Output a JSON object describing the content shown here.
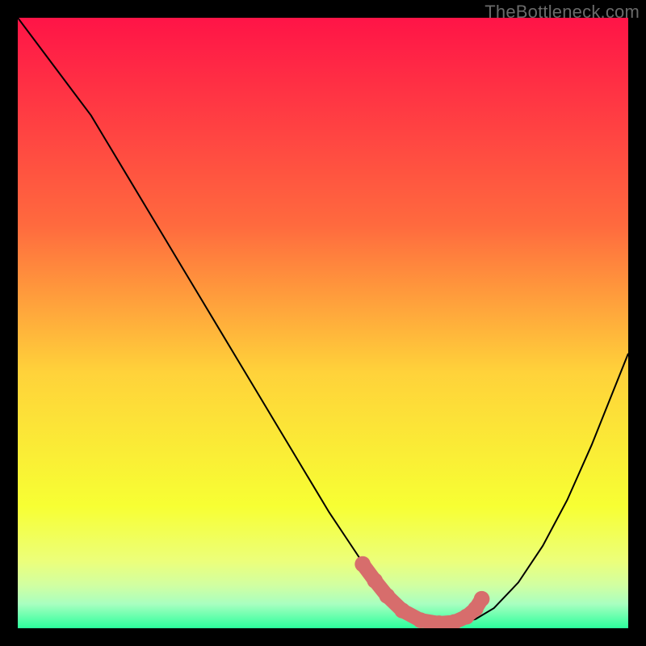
{
  "watermark": {
    "text": "TheBottleneck.com"
  },
  "colors": {
    "black": "#000000",
    "curve": "#000000",
    "marker": "#d76d6c",
    "grad_top": "#ff1447",
    "grad_mid1": "#ff6a3e",
    "grad_mid2": "#ffd23a",
    "grad_mid3": "#f7ff33",
    "grad_band1": "#ecff7a",
    "grad_band2": "#d1ffa2",
    "grad_band3": "#a9ffc0",
    "grad_bottom": "#2bff9c"
  },
  "chart_data": {
    "type": "line",
    "title": "",
    "xlabel": "",
    "ylabel": "",
    "xlim": [
      0,
      100
    ],
    "ylim": [
      0,
      100
    ],
    "series": [
      {
        "name": "bottleneck-curve",
        "x": [
          0,
          3,
          6,
          9,
          12,
          15,
          18,
          21,
          24,
          27,
          30,
          33,
          36,
          39,
          42,
          45,
          48,
          51,
          54,
          57,
          60,
          62,
          64,
          66,
          68,
          70,
          72,
          75,
          78,
          82,
          86,
          90,
          94,
          98,
          100
        ],
        "y": [
          100,
          96,
          92,
          88,
          84,
          79,
          74,
          69,
          64,
          59,
          54,
          49,
          44,
          39,
          34,
          29,
          24,
          19,
          14.5,
          10,
          6,
          4,
          2.5,
          1.4,
          0.8,
          0.6,
          0.8,
          1.5,
          3.3,
          7.5,
          13.5,
          21,
          30,
          40,
          45
        ]
      }
    ],
    "markers": {
      "name": "optimal-range",
      "x": [
        56.5,
        58.5,
        60.5,
        63,
        66,
        69,
        71.5,
        73.5,
        75,
        76
      ],
      "y": [
        10.5,
        7.8,
        5.3,
        2.9,
        1.3,
        0.8,
        1.0,
        1.9,
        3.2,
        4.8
      ]
    }
  }
}
